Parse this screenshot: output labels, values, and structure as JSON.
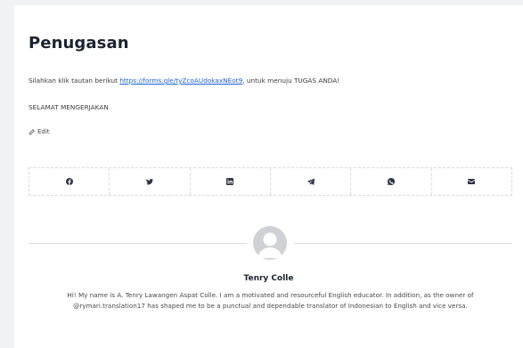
{
  "post": {
    "title": "Penugasan",
    "instruction_before": "Silahkan klik tautan berikut ",
    "form_link": "https://forms.gle/tyZcoAUdokaxNEot9",
    "instruction_after": ", untuk menuju TUGAS ANDA!",
    "closing": "SELAMAT MENGERJAKAN",
    "edit_label": "Edit"
  },
  "share": {
    "buttons": [
      {
        "icon": "facebook-icon"
      },
      {
        "icon": "twitter-icon"
      },
      {
        "icon": "linkedin-icon"
      },
      {
        "icon": "telegram-icon"
      },
      {
        "icon": "whatsapp-icon"
      },
      {
        "icon": "email-icon"
      }
    ]
  },
  "author": {
    "name": "Tenry Colle",
    "bio": "Hi! My name is A. Tenry Lawangen Aspat Colle. I am a motivated and resourceful English educator. In addition, as the owner of @rymari.translation17 has shaped me to be a punctual and dependable translator of Indonesian to English and vice versa."
  },
  "colors": {
    "link": "#1e62d0",
    "heading": "#1c2330",
    "icon": "#2c3342"
  }
}
